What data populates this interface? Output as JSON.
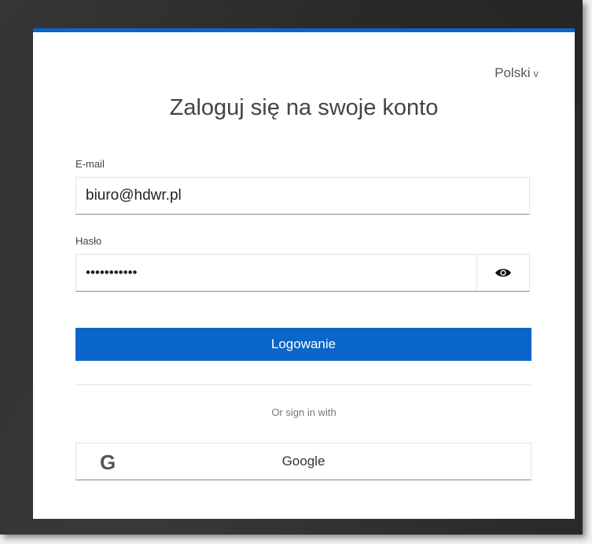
{
  "header": {
    "language": "Polski",
    "language_chevron": "v",
    "title": "Zaloguj się na swoje konto"
  },
  "form": {
    "email_label": "E-mail",
    "email_value": "biuro@hdwr.pl",
    "password_label": "Hasło",
    "password_value": "•••••••••••",
    "submit_label": "Logowanie"
  },
  "alt_login": {
    "or_text": "Or sign in with",
    "google_icon": "G",
    "google_label": "Google"
  },
  "icons": {
    "show_password": "eye-icon",
    "google": "google-icon"
  },
  "colors": {
    "accent": "#0a66c8",
    "frame_background": "#2b2b2b",
    "card_background": "#ffffff"
  }
}
